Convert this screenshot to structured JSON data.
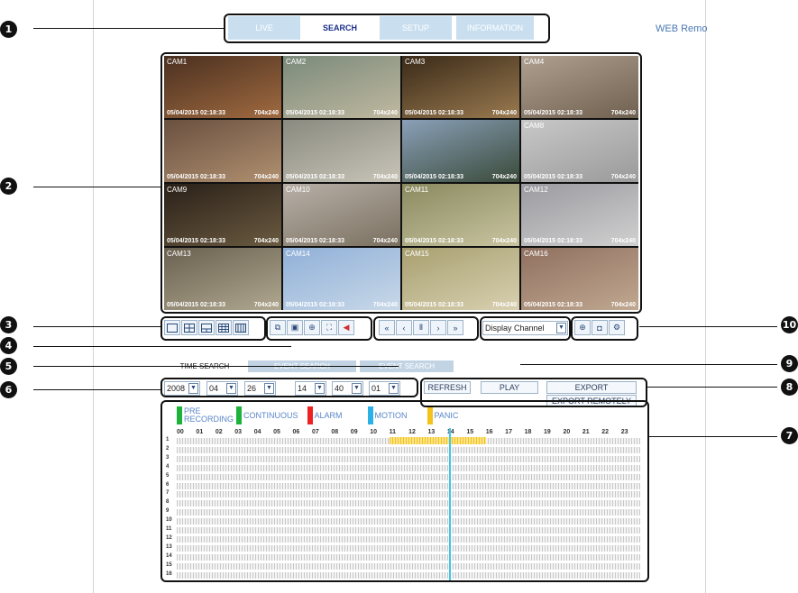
{
  "tabs": [
    {
      "label": "LIVE",
      "active": false
    },
    {
      "label": "SEARCH",
      "active": true
    },
    {
      "label": "SETUP",
      "active": false
    },
    {
      "label": "INFORMATION",
      "active": false
    }
  ],
  "brand": "WEB Remo",
  "cameras": [
    {
      "name": "CAM1",
      "time": "05/04/2015 02:18:33",
      "res": "704x240"
    },
    {
      "name": "CAM2",
      "time": "05/04/2015 02:18:33",
      "res": "704x240"
    },
    {
      "name": "CAM3",
      "time": "05/04/2015 02:18:33",
      "res": "704x240"
    },
    {
      "name": "CAM4",
      "time": "05/04/2015 02:18:33",
      "res": "704x240"
    },
    {
      "name": "",
      "time": "05/04/2015 02:18:33",
      "res": "704x240"
    },
    {
      "name": "",
      "time": "05/04/2015 02:18:33",
      "res": "704x240"
    },
    {
      "name": "",
      "time": "05/04/2015 02:18:33",
      "res": "704x240"
    },
    {
      "name": "CAM8",
      "time": "05/04/2015 02:18:33",
      "res": "704x240"
    },
    {
      "name": "CAM9",
      "time": "05/04/2015 02:18:33",
      "res": "704x240"
    },
    {
      "name": "CAM10",
      "time": "05/04/2015 02:18:33",
      "res": "704x240"
    },
    {
      "name": "CAM11",
      "time": "05/04/2015 02:18:33",
      "res": "704x240"
    },
    {
      "name": "CAM12",
      "time": "05/04/2015 02:18:33",
      "res": "704x240"
    },
    {
      "name": "CAM13",
      "time": "05/04/2015 02:18:33",
      "res": "704x240"
    },
    {
      "name": "CAM14",
      "time": "05/04/2015 02:18:33",
      "res": "704x240"
    },
    {
      "name": "CAM15",
      "time": "05/04/2015 02:18:33",
      "res": "704x240"
    },
    {
      "name": "CAM16",
      "time": "05/04/2015 02:18:33",
      "res": "704x240"
    }
  ],
  "display_channel": "Display Channel",
  "search_tabs": [
    {
      "label": "TIME SEARCH",
      "active": true
    },
    {
      "label": "EVENT SEARCH",
      "active": false
    },
    {
      "label": "EVENT SEARCH",
      "active": false
    }
  ],
  "date": {
    "year": "2008",
    "month": "04",
    "day": "26",
    "hour": "14",
    "minute": "40",
    "second": "01"
  },
  "buttons": {
    "refresh": "REFRESH",
    "play": "PLAY",
    "export": "EXPORT",
    "export_remotely": "EXPORT REMOTELY"
  },
  "legend": [
    {
      "label": "PRE RECORDING",
      "color": "#1db33a"
    },
    {
      "label": "CONTINUOUS",
      "color": "#1db33a"
    },
    {
      "label": "ALARM",
      "color": "#ee2222"
    },
    {
      "label": "MOTION",
      "color": "#2ab2e8"
    },
    {
      "label": "PANIC",
      "color": "#f5c21a"
    }
  ],
  "hours": [
    "00",
    "01",
    "02",
    "03",
    "04",
    "05",
    "06",
    "07",
    "08",
    "09",
    "10",
    "11",
    "12",
    "13",
    "14",
    "15",
    "16",
    "17",
    "18",
    "19",
    "20",
    "21",
    "22",
    "23"
  ],
  "channels": [
    "1",
    "2",
    "3",
    "4",
    "5",
    "6",
    "7",
    "8",
    "9",
    "10",
    "11",
    "12",
    "13",
    "14",
    "15",
    "16"
  ],
  "callouts": [
    "1",
    "2",
    "3",
    "4",
    "5",
    "6",
    "7",
    "8",
    "9",
    "10"
  ],
  "panic_range_hours": [
    11,
    16
  ],
  "cursor_hour": 14.1
}
